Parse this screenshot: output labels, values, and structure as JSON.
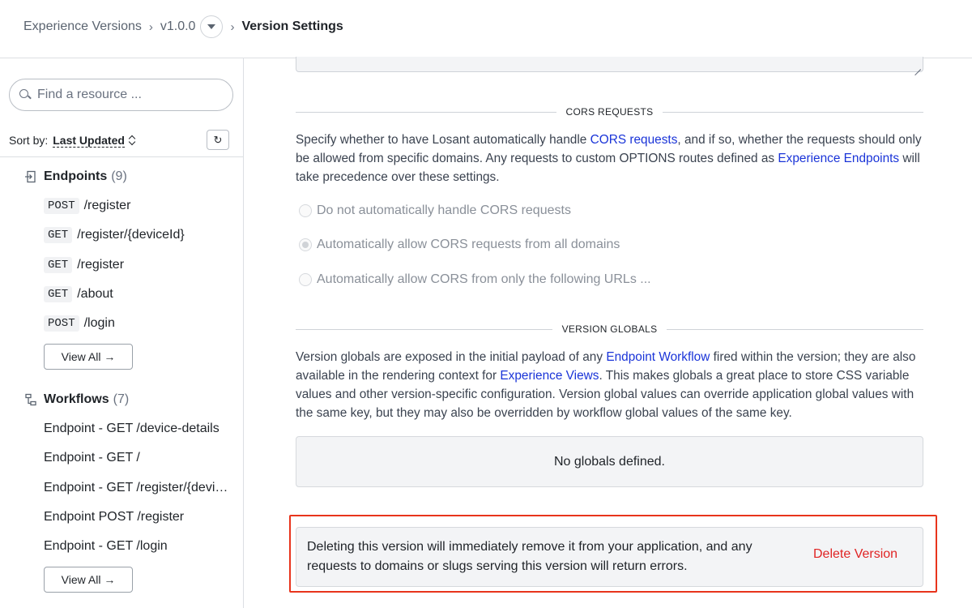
{
  "breadcrumb": {
    "root": "Experience Versions",
    "version": "v1.0.0",
    "current": "Version Settings"
  },
  "sidebar": {
    "search_placeholder": "Find a resource ...",
    "sort_label": "Sort by:",
    "sort_value": "Last Updated",
    "endpoints": {
      "title": "Endpoints",
      "count": "(9)",
      "items": [
        {
          "method": "POST",
          "path": "/register"
        },
        {
          "method": "GET",
          "path": "/register/{deviceId}"
        },
        {
          "method": "GET",
          "path": "/register"
        },
        {
          "method": "GET",
          "path": "/about"
        },
        {
          "method": "POST",
          "path": "/login"
        }
      ],
      "view_all": "View All →"
    },
    "workflows": {
      "title": "Workflows",
      "count": "(7)",
      "items": [
        "Endpoint - GET /device-details",
        "Endpoint - GET /",
        "Endpoint - GET /register/{deviceId}",
        "Endpoint POST /register",
        "Endpoint - GET /login"
      ],
      "view_all": "View All →"
    }
  },
  "cors": {
    "heading": "CORS REQUESTS",
    "desc_1": "Specify whether to have Losant automatically handle ",
    "desc_link_1": "CORS requests",
    "desc_2": ", and if so, whether the requests should only be allowed from specific domains. Any requests to custom OPTIONS routes defined as ",
    "desc_link_2": "Experience Endpoints",
    "desc_3": " will take precedence over these settings.",
    "options": [
      "Do not automatically handle CORS requests",
      "Automatically allow CORS requests from all domains",
      "Automatically allow CORS from only the following URLs ..."
    ]
  },
  "globals": {
    "heading": "VERSION GLOBALS",
    "desc_1": "Version globals are exposed in the initial payload of any ",
    "desc_link_1": "Endpoint Workflow",
    "desc_2": " fired within the version; they are also available in the rendering context for ",
    "desc_link_2": "Experience Views",
    "desc_3": ". This makes globals a great place to store CSS variable values and other version-specific configuration. Version global values can override application global values with the same key, but they may also be overridden by workflow global values of the same key.",
    "empty": "No globals defined."
  },
  "danger": {
    "text": "Deleting this version will immediately remove it from your application, and any requests to domains or slugs serving this version will return errors.",
    "delete_label": "Delete Version"
  }
}
